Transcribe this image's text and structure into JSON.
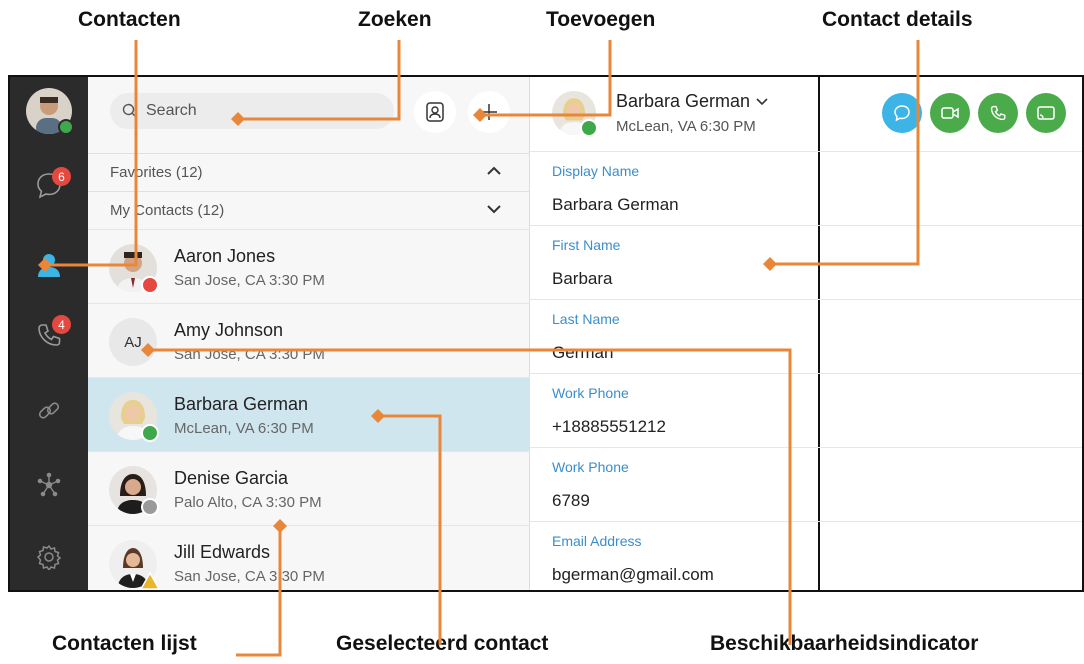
{
  "callouts": {
    "contacten": "Contacten",
    "zoeken": "Zoeken",
    "toevoegen": "Toevoegen",
    "contact_details": "Contact details",
    "contacten_lijst": "Contacten lijst",
    "geselecteerd": "Geselecteerd contact",
    "beschikbaarheid": "Beschikbaarheidsindicator"
  },
  "rail": {
    "messages_badge": "6",
    "calls_badge": "4"
  },
  "search": {
    "placeholder": "Search"
  },
  "sections": {
    "favorites": "Favorites (12)",
    "my_contacts": "My Contacts (12)"
  },
  "contacts": [
    {
      "name": "Aaron Jones",
      "location": "San Jose, CA 3:30 PM",
      "presence": "busy"
    },
    {
      "name": "Amy Johnson",
      "location": "San Jose, CA 3:30 PM",
      "initials": "AJ"
    },
    {
      "name": "Barbara German",
      "location": "McLean, VA 6:30 PM",
      "presence": "available"
    },
    {
      "name": "Denise Garcia",
      "location": "Palo Alto, CA 3:30 PM",
      "presence": "offline"
    },
    {
      "name": "Jill Edwards",
      "location": "San Jose, CA 3:30 PM",
      "presence": "away"
    }
  ],
  "detail": {
    "header_name": "Barbara German",
    "header_location": "McLean, VA 6:30 PM",
    "fields": [
      {
        "label": "Display Name",
        "value": "Barbara German"
      },
      {
        "label": "First Name",
        "value": "Barbara"
      },
      {
        "label": "Last Name",
        "value": "German"
      },
      {
        "label": "Work Phone",
        "value": "+18885551212"
      },
      {
        "label": "Work Phone",
        "value": "6789"
      },
      {
        "label": "Email Address",
        "value": "bgerman@gmail.com"
      }
    ]
  },
  "colors": {
    "accent_orange": "#e8873a",
    "presence_available": "#3fa84a",
    "presence_busy": "#e5483f",
    "presence_away": "#e9b52a",
    "presence_offline": "#9a9a9a",
    "chat_button": "#3cb4e5",
    "call_button": "#4bab4a",
    "selected_row": "#cfe6ee"
  }
}
